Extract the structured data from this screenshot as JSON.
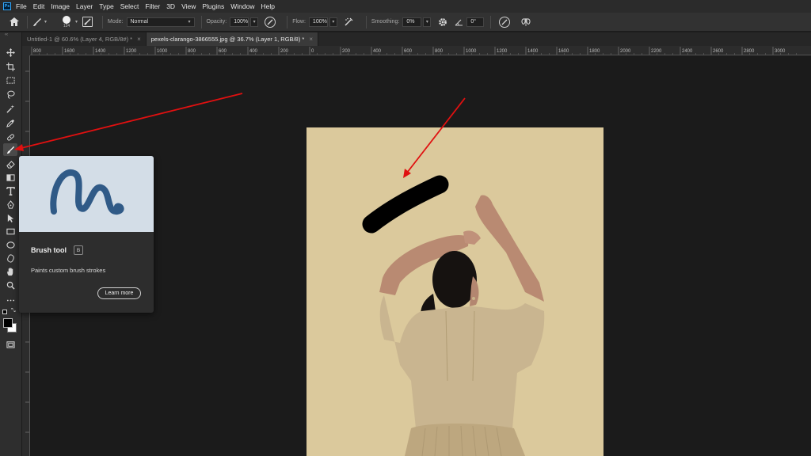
{
  "menu": {
    "logo": "Ps",
    "items": [
      "File",
      "Edit",
      "Image",
      "Layer",
      "Type",
      "Select",
      "Filter",
      "3D",
      "View",
      "Plugins",
      "Window",
      "Help"
    ]
  },
  "options": {
    "brush_size": "124",
    "mode_label": "Mode:",
    "mode_value": "Normal",
    "opacity_label": "Opacity:",
    "opacity_value": "100%",
    "flow_label": "Flow:",
    "flow_value": "100%",
    "smoothing_label": "Smoothing:",
    "smoothing_value": "0%",
    "angle_value": "0°"
  },
  "tabs": [
    {
      "label": "Untitled-1 @ 60.6% (Layer 4, RGB/8#) *",
      "close": "×"
    },
    {
      "label": "pexels-clarango-3866555.jpg @ 36.7% (Layer 1, RGB/8) *",
      "close": "×"
    }
  ],
  "ruler": {
    "h_labels": [
      "800",
      "1600",
      "1400",
      "1200",
      "1000",
      "800",
      "600",
      "400",
      "200",
      "0",
      "200",
      "400",
      "600",
      "800",
      "1000",
      "1200",
      "1400",
      "1600",
      "1800",
      "2000",
      "2200",
      "2400",
      "2600",
      "2800",
      "3000"
    ]
  },
  "tooltip": {
    "title": "Brush tool",
    "shortcut": "B",
    "description": "Paints custom brush strokes",
    "learn_more": "Learn more"
  },
  "colors": {
    "foreground": "#000000",
    "background": "#ffffff",
    "annotation_arrow": "#e01010",
    "canvas_background": "#dbc99c"
  },
  "icons": [
    "home-icon",
    "brush-preset-icon",
    "brush-settings-icon",
    "pressure-opacity-icon",
    "airbrush-icon",
    "settings-gear-icon",
    "angle-icon",
    "pressure-size-icon",
    "symmetry-icon"
  ]
}
